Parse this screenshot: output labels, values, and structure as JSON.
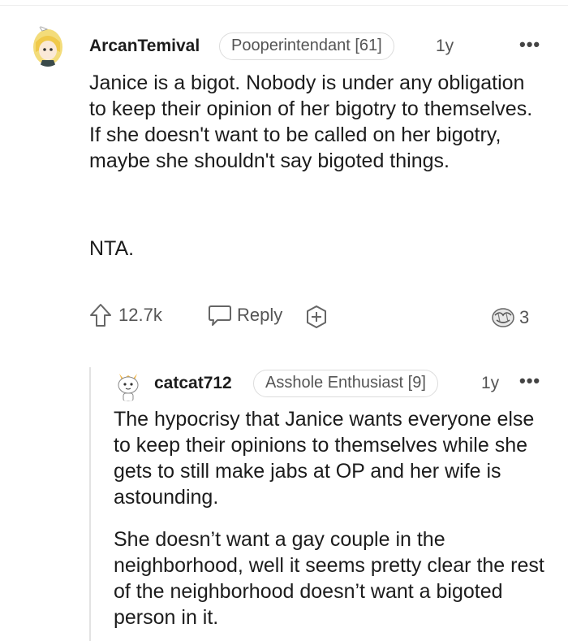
{
  "comment": {
    "username": "ArcanTemival",
    "flair": "Pooperintendant [61]",
    "age": "1y",
    "more": "•••",
    "paragraphs": [
      "Janice is a bigot. Nobody is under any obligation to keep their opinion of her bigotry to themselves. If she doesn't want to be called on her bigotry, maybe she shouldn't say bigoted things.",
      "NTA."
    ],
    "upvotes": "12.7k",
    "reply_label": "Reply",
    "awards_count": "3"
  },
  "reply": {
    "username": "catcat712",
    "flair": "Asshole Enthusiast [9]",
    "age": "1y",
    "more": "•••",
    "paragraphs": [
      "The hypocrisy that Janice wants everyone else to keep their opinions to themselves while she gets to still make jabs at OP and her wife is astounding.",
      "She doesn’t want a gay couple in the neighborhood, well it seems pretty clear the rest of the neighborhood doesn’t want a bigoted person in it."
    ]
  },
  "icons": [
    "avatar-anime-girl",
    "upvote-arrow-icon",
    "reply-bubble-icon",
    "add-award-icon",
    "award-hands-icon",
    "avatar-cat"
  ]
}
